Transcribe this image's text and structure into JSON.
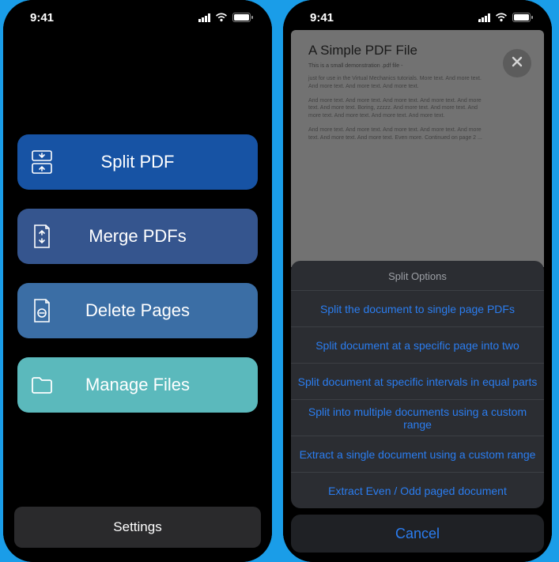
{
  "status": {
    "time": "9:41"
  },
  "left": {
    "menu": {
      "split": {
        "label": "Split PDF"
      },
      "merge": {
        "label": "Merge PDFs"
      },
      "delete": {
        "label": "Delete Pages"
      },
      "manage": {
        "label": "Manage Files"
      }
    },
    "settings_label": "Settings"
  },
  "right": {
    "pdf": {
      "title": "A Simple PDF File",
      "subtitle": "This is a small demonstration .pdf file -",
      "para1": "just for use in the Virtual Mechanics tutorials. More text. And more text. And more text. And more text. And more text.",
      "para2": "And more text. And more text. And more text. And more text. And more text. And more text. Boring, zzzzz. And more text. And more text. And more text. And more text. And more text. And more text.",
      "para3": "And more text. And more text. And more text. And more text. And more text. And more text. And more text. Even more. Continued on page 2 ..."
    },
    "sheet": {
      "title": "Split Options",
      "items": [
        "Split the document to single page PDFs",
        "Split document at a specific page into two",
        "Split document at specific intervals in equal parts",
        "Split into multiple documents using a custom range",
        "Extract a single document using a custom range",
        "Extract Even / Odd paged document"
      ],
      "cancel": "Cancel"
    }
  }
}
